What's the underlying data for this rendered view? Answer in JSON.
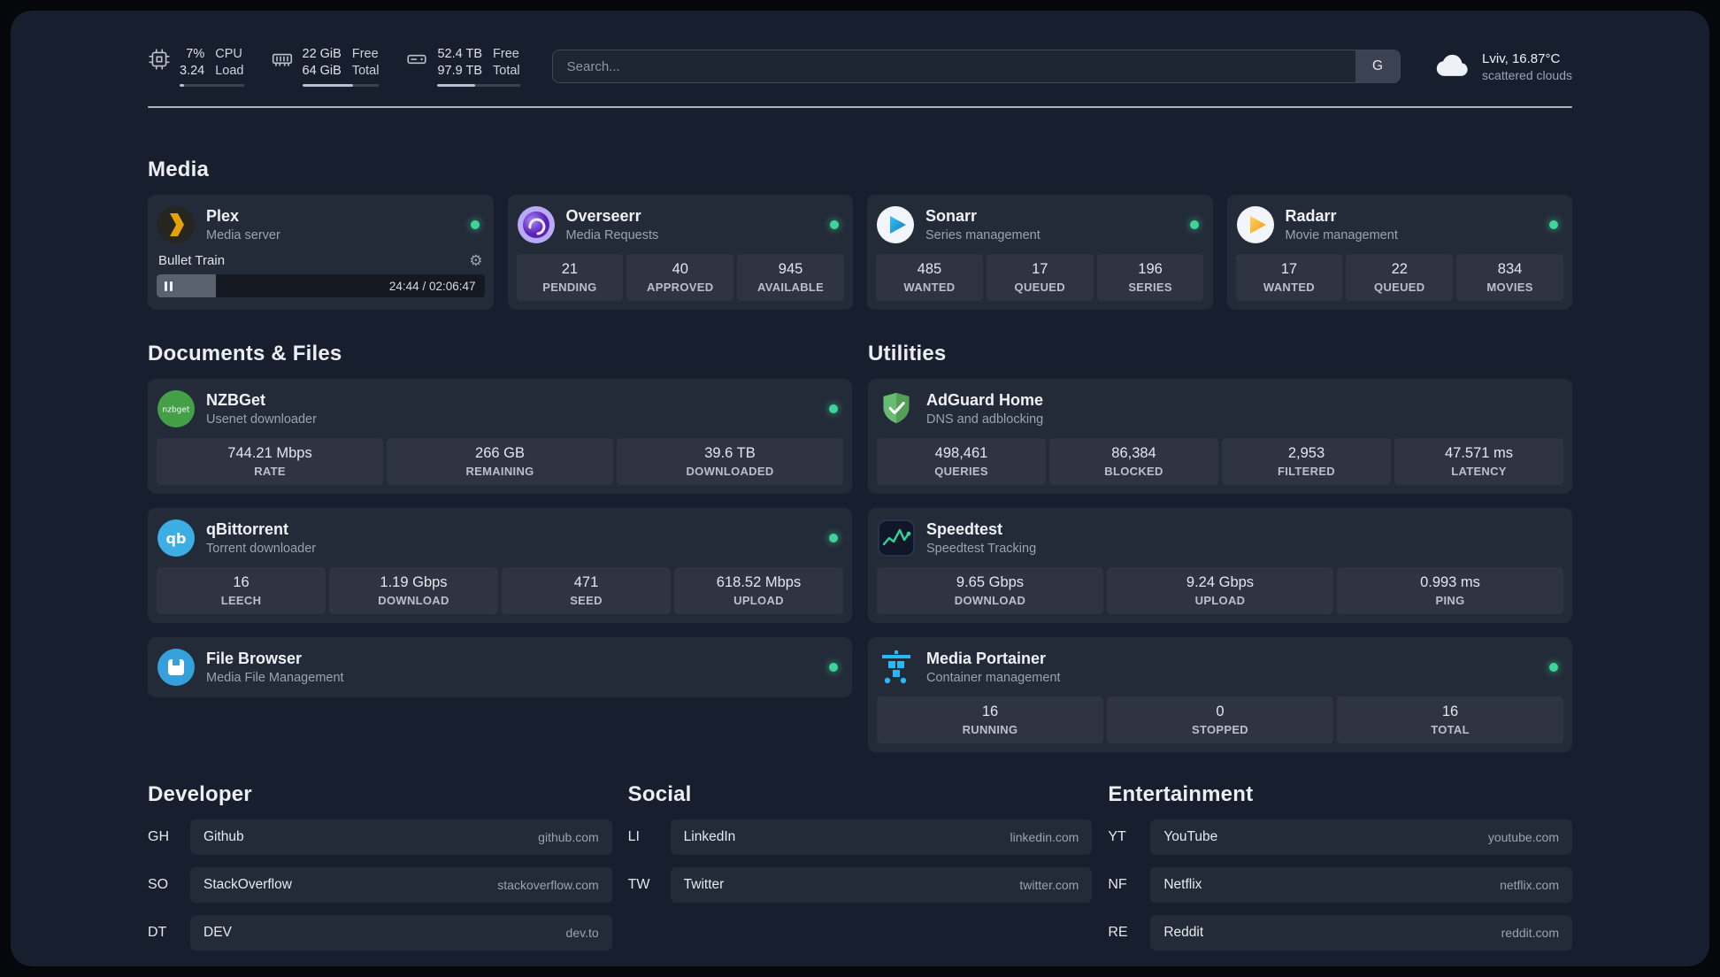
{
  "topbar": {
    "cpu": {
      "value_top": "7%",
      "value_bottom": "3.24",
      "label_top": "CPU",
      "label_bottom": "Load",
      "percent": 7
    },
    "memory": {
      "value_top": "22 GiB",
      "value_bottom": "64 GiB",
      "label_top": "Free",
      "label_bottom": "Total",
      "percent": 66
    },
    "disk": {
      "value_top": "52.4 TB",
      "value_bottom": "97.9 TB",
      "label_top": "Free",
      "label_bottom": "Total",
      "percent": 46
    },
    "search": {
      "placeholder": "Search...",
      "provider": "G"
    },
    "weather": {
      "location": "Lviv, 16.87°C",
      "condition": "scattered clouds"
    }
  },
  "media": {
    "title": "Media",
    "cards": [
      {
        "name": "Plex",
        "desc": "Media server",
        "status": "online",
        "player": {
          "track": "Bullet Train",
          "time": "24:44 / 02:06:47",
          "progress": 18
        }
      },
      {
        "name": "Overseerr",
        "desc": "Media Requests",
        "status": "online",
        "stats": [
          {
            "value": "21",
            "label": "PENDING"
          },
          {
            "value": "40",
            "label": "APPROVED"
          },
          {
            "value": "945",
            "label": "AVAILABLE"
          }
        ]
      },
      {
        "name": "Sonarr",
        "desc": "Series management",
        "status": "online",
        "stats": [
          {
            "value": "485",
            "label": "WANTED"
          },
          {
            "value": "17",
            "label": "QUEUED"
          },
          {
            "value": "196",
            "label": "SERIES"
          }
        ]
      },
      {
        "name": "Radarr",
        "desc": "Movie management",
        "status": "online",
        "stats": [
          {
            "value": "17",
            "label": "WANTED"
          },
          {
            "value": "22",
            "label": "QUEUED"
          },
          {
            "value": "834",
            "label": "MOVIES"
          }
        ]
      }
    ]
  },
  "documents": {
    "title": "Documents & Files",
    "cards": [
      {
        "name": "NZBGet",
        "desc": "Usenet downloader",
        "status": "online",
        "stats": [
          {
            "value": "744.21 Mbps",
            "label": "RATE"
          },
          {
            "value": "266 GB",
            "label": "REMAINING"
          },
          {
            "value": "39.6 TB",
            "label": "DOWNLOADED"
          }
        ]
      },
      {
        "name": "qBittorrent",
        "desc": "Torrent downloader",
        "status": "online",
        "stats": [
          {
            "value": "16",
            "label": "LEECH"
          },
          {
            "value": "1.19 Gbps",
            "label": "DOWNLOAD"
          },
          {
            "value": "471",
            "label": "SEED"
          },
          {
            "value": "618.52 Mbps",
            "label": "UPLOAD"
          }
        ]
      },
      {
        "name": "File Browser",
        "desc": "Media File Management",
        "status": "online"
      }
    ]
  },
  "utilities": {
    "title": "Utilities",
    "cards": [
      {
        "name": "AdGuard Home",
        "desc": "DNS and adblocking",
        "stats": [
          {
            "value": "498,461",
            "label": "QUERIES"
          },
          {
            "value": "86,384",
            "label": "BLOCKED"
          },
          {
            "value": "2,953",
            "label": "FILTERED"
          },
          {
            "value": "47.571 ms",
            "label": "LATENCY"
          }
        ]
      },
      {
        "name": "Speedtest",
        "desc": "Speedtest Tracking",
        "stats": [
          {
            "value": "9.65 Gbps",
            "label": "DOWNLOAD"
          },
          {
            "value": "9.24 Gbps",
            "label": "UPLOAD"
          },
          {
            "value": "0.993 ms",
            "label": "PING"
          }
        ]
      },
      {
        "name": "Media Portainer",
        "desc": "Container management",
        "status": "online",
        "stats": [
          {
            "value": "16",
            "label": "RUNNING"
          },
          {
            "value": "0",
            "label": "STOPPED"
          },
          {
            "value": "16",
            "label": "TOTAL"
          }
        ]
      }
    ]
  },
  "bookmarks": [
    {
      "title": "Developer",
      "items": [
        {
          "abbr": "GH",
          "name": "Github",
          "domain": "github.com"
        },
        {
          "abbr": "SO",
          "name": "StackOverflow",
          "domain": "stackoverflow.com"
        },
        {
          "abbr": "DT",
          "name": "DEV",
          "domain": "dev.to"
        }
      ]
    },
    {
      "title": "Social",
      "items": [
        {
          "abbr": "LI",
          "name": "LinkedIn",
          "domain": "linkedin.com"
        },
        {
          "abbr": "TW",
          "name": "Twitter",
          "domain": "twitter.com"
        }
      ]
    },
    {
      "title": "Entertainment",
      "items": [
        {
          "abbr": "YT",
          "name": "YouTube",
          "domain": "youtube.com"
        },
        {
          "abbr": "NF",
          "name": "Netflix",
          "domain": "netflix.com"
        },
        {
          "abbr": "RE",
          "name": "Reddit",
          "domain": "reddit.com"
        }
      ]
    }
  ]
}
